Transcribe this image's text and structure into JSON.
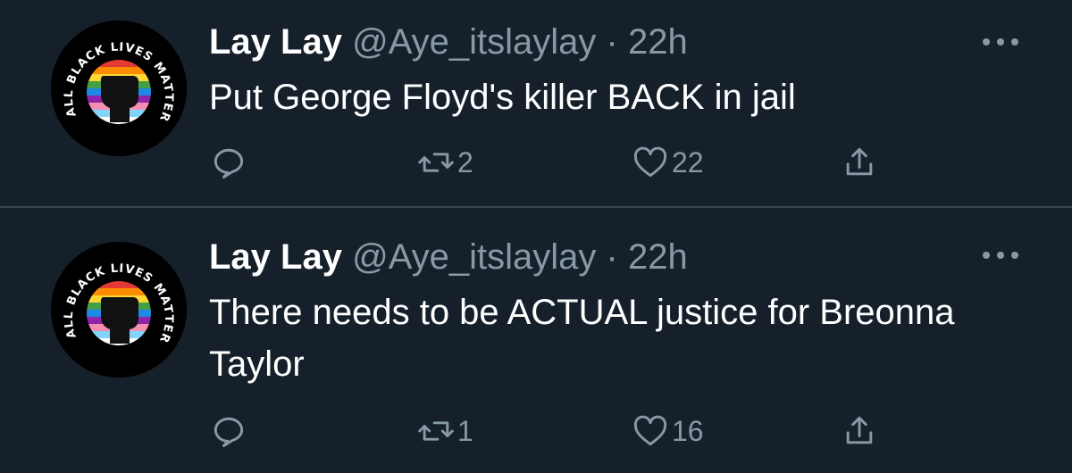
{
  "colors": {
    "background": "#15202b",
    "text": "#ffffff",
    "secondary": "#8899a6",
    "divider": "#38444d"
  },
  "tweets": [
    {
      "avatar_icon": "all-black-lives-matter-fist-avatar",
      "avatar_text": "ALL BLACK LIVES MATTER",
      "name": "Lay Lay",
      "handle": "@Aye_itslaylay",
      "separator": "·",
      "time": "22h",
      "text": "Put George Floyd's killer BACK in jail",
      "retweets": "2",
      "likes": "22"
    },
    {
      "avatar_icon": "all-black-lives-matter-fist-avatar",
      "avatar_text": "ALL BLACK LIVES MATTER",
      "name": "Lay Lay",
      "handle": "@Aye_itslaylay",
      "separator": "·",
      "time": "22h",
      "text": "There needs to be ACTUAL justice for Breonna Taylor",
      "retweets": "1",
      "likes": "16"
    }
  ]
}
